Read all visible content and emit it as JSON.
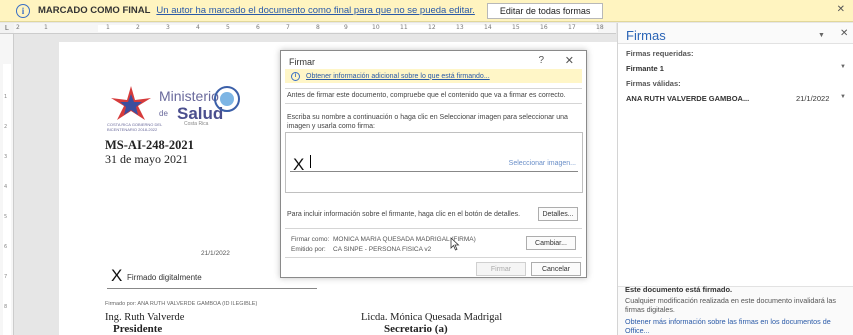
{
  "message_bar": {
    "info_icon": "i",
    "title": "MARCADO COMO FINAL",
    "link": "Un autor ha marcado el documento como final para que no se pueda editar.",
    "edit_button": "Editar de todas formas",
    "close": "✕"
  },
  "ruler": {
    "corner": "L",
    "top_numbers": [
      "2",
      "1",
      "1",
      "2",
      "3",
      "4",
      "5",
      "6",
      "7",
      "8",
      "9",
      "10",
      "11",
      "12",
      "13",
      "14",
      "15",
      "16",
      "17",
      "18"
    ],
    "left_numbers": [
      "1",
      "2",
      "3",
      "4",
      "5",
      "6",
      "7",
      "8"
    ]
  },
  "document": {
    "logo": {
      "ministerio": "Ministerio",
      "de": "de",
      "salud": "Salud",
      "country": "Costa Rica",
      "small_text": "COSTA RICA GOBIERNO DEL BICENTENARIO 2018-2022"
    },
    "doc_number": "MS-AI-248-2021",
    "doc_date": "31 de mayo 2021",
    "signature": {
      "date": "21/1/2022",
      "x_mark": "X",
      "label": "Firmado digitalmente",
      "signed_by": "Firmado por: ANA RUTH VALVERDE GAMBOA (ID ILEGIBLE)"
    },
    "signer1": {
      "name": "Ing. Ruth Valverde",
      "role": "Presidente"
    },
    "signer2": {
      "name": "Licda. Mónica Quesada Madrigal",
      "role": "Secretario (a)"
    }
  },
  "dialog": {
    "title": "Firmar",
    "help": "?",
    "close": "✕",
    "info_icon": "i",
    "info_link": "Obtener información adicional sobre lo que está firmando...",
    "intro": "Antes de firmar este documento, compruebe que el contenido que va a firmar es correcto.",
    "instructions": "Escriba su nombre a continuación o haga clic en Seleccionar imagen para seleccionar una imagen y usarla como firma:",
    "x_mark": "X",
    "select_image": "Seleccionar imagen...",
    "details_text": "Para incluir información sobre el firmante, haga clic en el botón de detalles.",
    "details_button": "Detalles...",
    "sign_as_label": "Firmar como:",
    "sign_as_value": "MONICA MARIA QUESADA MADRIGAL (FIRMA)",
    "issued_by_label": "Emitido por:",
    "issued_by_value": "CA SINPE - PERSONA FISICA v2",
    "change_button": "Cambiar...",
    "sign_button": "Firmar",
    "cancel_button": "Cancelar"
  },
  "pane": {
    "title": "Firmas",
    "dropdown": "▼",
    "close": "✕",
    "required_header": "Firmas requeridas:",
    "required_item": "Firmante 1",
    "valid_header": "Firmas válidas:",
    "valid_item_name": "ANA RUTH VALVERDE GAMBOA...",
    "valid_item_date": "21/1/2022",
    "footer_title": "Este documento está firmado.",
    "footer_text": "Cualquier modificación realizada en este documento invalidará las firmas digitales.",
    "footer_link": "Obtener más información sobre las firmas en los documentos de Office..."
  }
}
